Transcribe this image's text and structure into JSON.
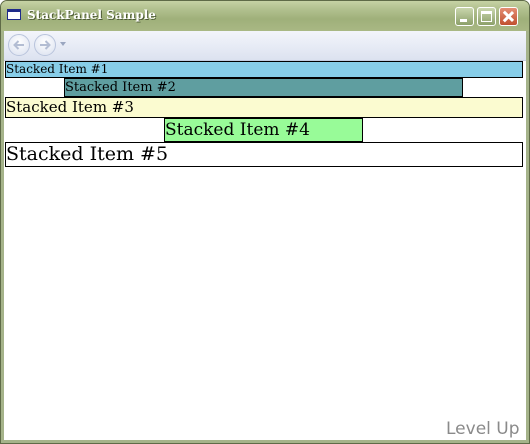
{
  "window": {
    "title": "StackPanel Sample"
  },
  "caption_buttons": {
    "minimize_icon": "minimize-icon",
    "maximize_icon": "maximize-icon",
    "close_icon": "close-icon"
  },
  "navigation": {
    "back_icon": "back-arrow-icon",
    "forward_icon": "forward-arrow-icon",
    "history_icon": "chevron-down-icon"
  },
  "stack": {
    "items": [
      {
        "label": "Stacked Item #1",
        "background": "#87cde8",
        "alignment": "stretch"
      },
      {
        "label": "Stacked Item #2",
        "background": "#5f9ea0",
        "alignment": "center"
      },
      {
        "label": "Stacked Item #3",
        "background": "#fbfbd0",
        "alignment": "stretch"
      },
      {
        "label": "Stacked Item #4",
        "background": "#98fb98",
        "alignment": "center"
      },
      {
        "label": "Stacked Item #5",
        "background": "#ffffff",
        "alignment": "stretch"
      }
    ]
  },
  "watermark": {
    "text": "Level Up"
  },
  "colors": {
    "titlebar": "#a5b38a",
    "item_border": "#000000"
  }
}
